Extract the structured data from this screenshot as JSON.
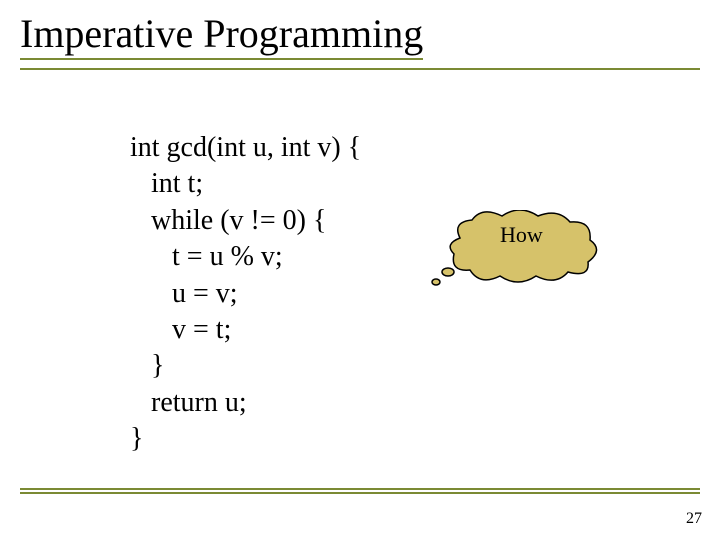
{
  "slide": {
    "title": "Imperative Programming",
    "code": {
      "l1": "int gcd(int u, int v) {",
      "l2": "   int t;",
      "l3": "   while (v != 0) {",
      "l4": "      t = u % v;",
      "l5": "      u = v;",
      "l6": "      v = t;",
      "l7": "   }",
      "l8": "   return u;",
      "l9": "}"
    },
    "bubble_text": "How",
    "page_number": "27",
    "colors": {
      "accent": "#7b8a34",
      "bubble_fill": "#d6c26a",
      "bubble_stroke": "#000000"
    }
  }
}
